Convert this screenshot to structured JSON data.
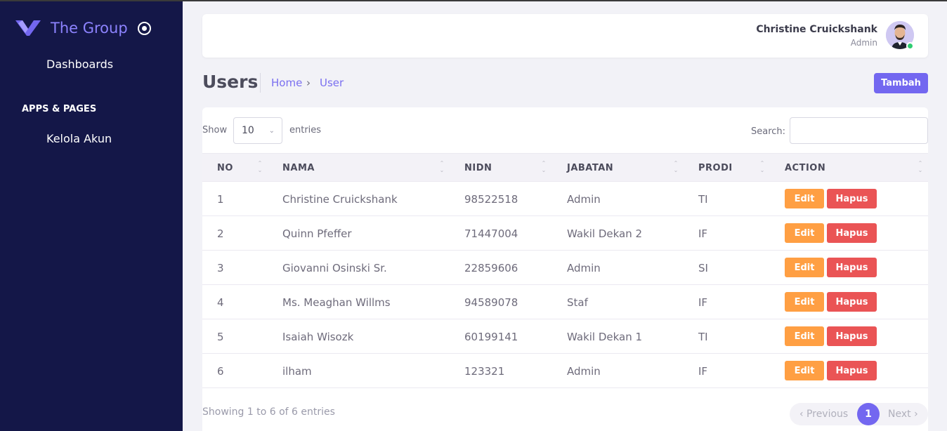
{
  "brand": {
    "name": "The Group",
    "accent": "#7367f0",
    "logo_icon": "v-logo-icon",
    "toggle_icon": "circle-dot-icon"
  },
  "sidebar": {
    "dashboards_label": "Dashboards",
    "section_label": "APPS & PAGES",
    "kelola_label": "Kelola Akun",
    "background": "#141748"
  },
  "header": {
    "user_name": "Christine Cruickshank",
    "user_role": "Admin",
    "status_color": "#2ecc71"
  },
  "page": {
    "title": "Users",
    "breadcrumb_home": "Home",
    "breadcrumb_sep": "›",
    "breadcrumb_current": "User",
    "add_button": "Tambah"
  },
  "table": {
    "show_label": "Show",
    "page_size": "10",
    "entries_label": "entries",
    "search_label": "Search:",
    "columns": [
      "NO",
      "NAMA",
      "NIDN",
      "JABATAN",
      "PRODI",
      "ACTION"
    ],
    "edit_label": "Edit",
    "delete_label": "Hapus",
    "rows": [
      {
        "no": "1",
        "nama": "Christine Cruickshank",
        "nidn": "98522518",
        "jabatan": "Admin",
        "prodi": "TI"
      },
      {
        "no": "2",
        "nama": "Quinn Pfeffer",
        "nidn": "71447004",
        "jabatan": "Wakil Dekan 2",
        "prodi": "IF"
      },
      {
        "no": "3",
        "nama": "Giovanni Osinski Sr.",
        "nidn": "22859606",
        "jabatan": "Admin",
        "prodi": "SI"
      },
      {
        "no": "4",
        "nama": "Ms. Meaghan Willms",
        "nidn": "94589078",
        "jabatan": "Staf",
        "prodi": "IF"
      },
      {
        "no": "5",
        "nama": "Isaiah Wisozk",
        "nidn": "60199141",
        "jabatan": "Wakil Dekan 1",
        "prodi": "TI"
      },
      {
        "no": "6",
        "nama": "ilham",
        "nidn": "123321",
        "jabatan": "Admin",
        "prodi": "IF"
      }
    ],
    "info": "Showing 1 to 6 of 6 entries",
    "pagination": {
      "previous": "‹ Previous",
      "current": "1",
      "next": "Next ›"
    }
  }
}
